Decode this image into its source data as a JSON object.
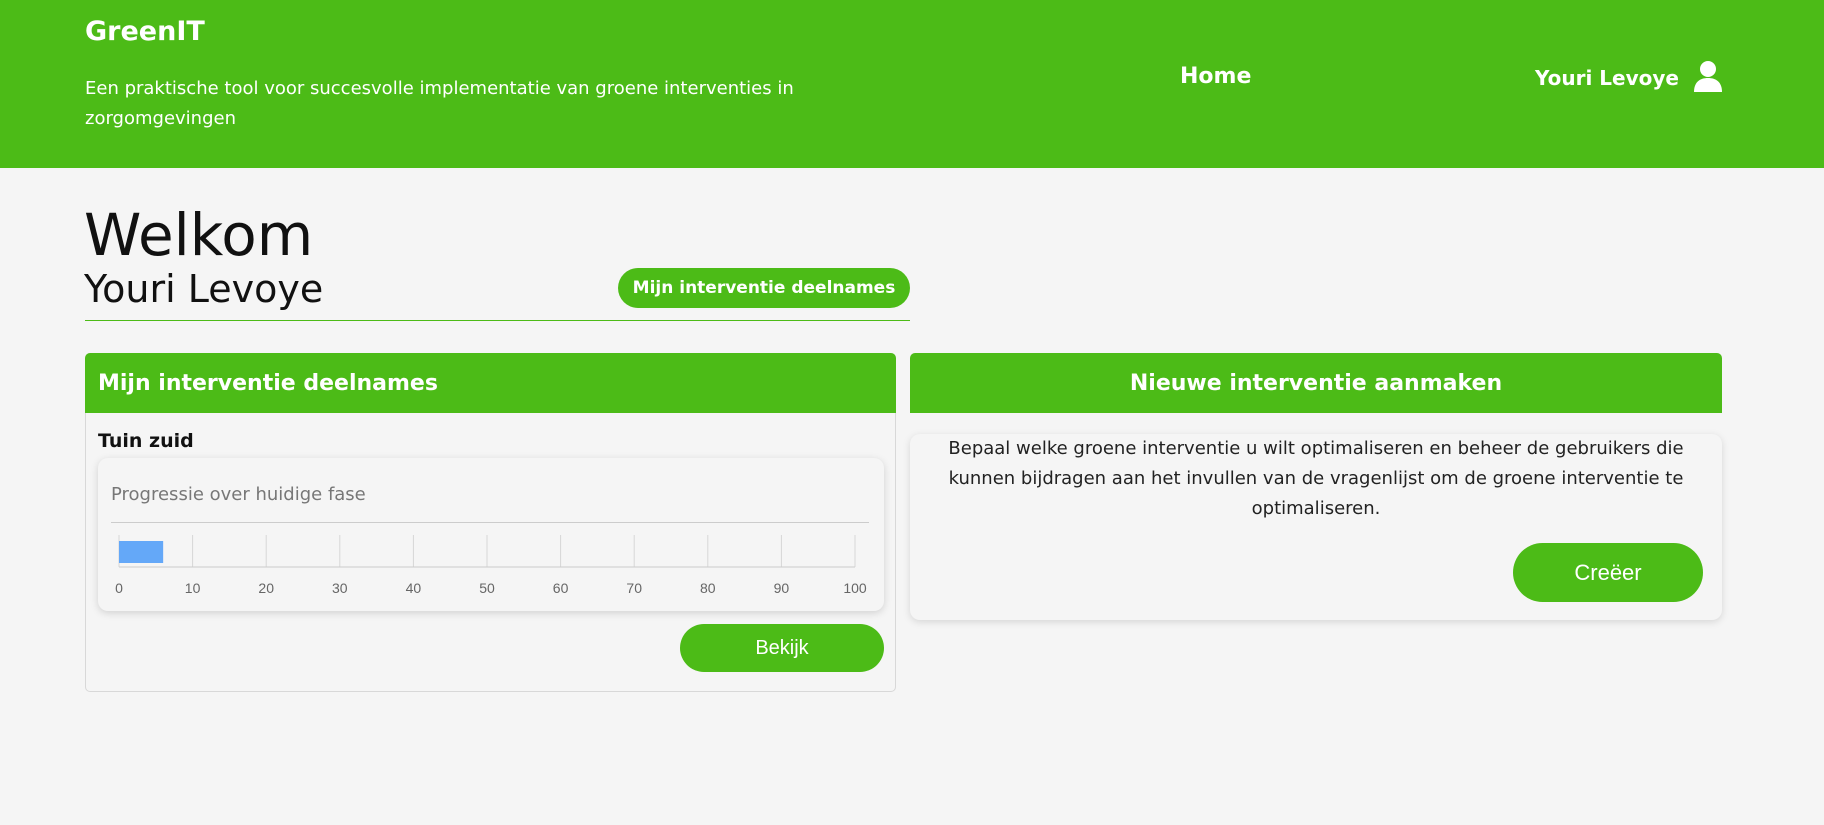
{
  "header": {
    "brand": "GreenIT",
    "tagline": "Een praktische tool voor succesvolle implementatie van groene interventies in zorgomgevingen",
    "nav_home": "Home",
    "user_name": "Youri Levoye",
    "user_icon": "user-icon"
  },
  "welcome": {
    "title": "Welkom",
    "username": "Youri Levoye",
    "participations_button": "Mijn interventie deelnames"
  },
  "participations_card": {
    "title": "Mijn interventie deelnames",
    "item_title": "Tuin zuid",
    "progress_label": "Progressie over huidige fase",
    "view_button": "Bekijk"
  },
  "new_card": {
    "title": "Nieuwe interventie aanmaken",
    "description": "Bepaal welke groene interventie u wilt optimaliseren en beheer de gebruikers die kunnen bijdragen aan het invullen van de vragenlijst om de groene interventie te optimaliseren.",
    "create_button": "Creëer"
  },
  "colors": {
    "brand_green": "#4cbb17",
    "bar_blue": "#64a8f8"
  },
  "chart_data": {
    "type": "bar",
    "orientation": "horizontal",
    "categories": [
      "Tuin zuid"
    ],
    "values": [
      6
    ],
    "xlim": [
      0,
      100
    ],
    "ticks": [
      "0",
      "10",
      "20",
      "30",
      "40",
      "50",
      "60",
      "70",
      "80",
      "90",
      "100"
    ],
    "grid": true
  }
}
